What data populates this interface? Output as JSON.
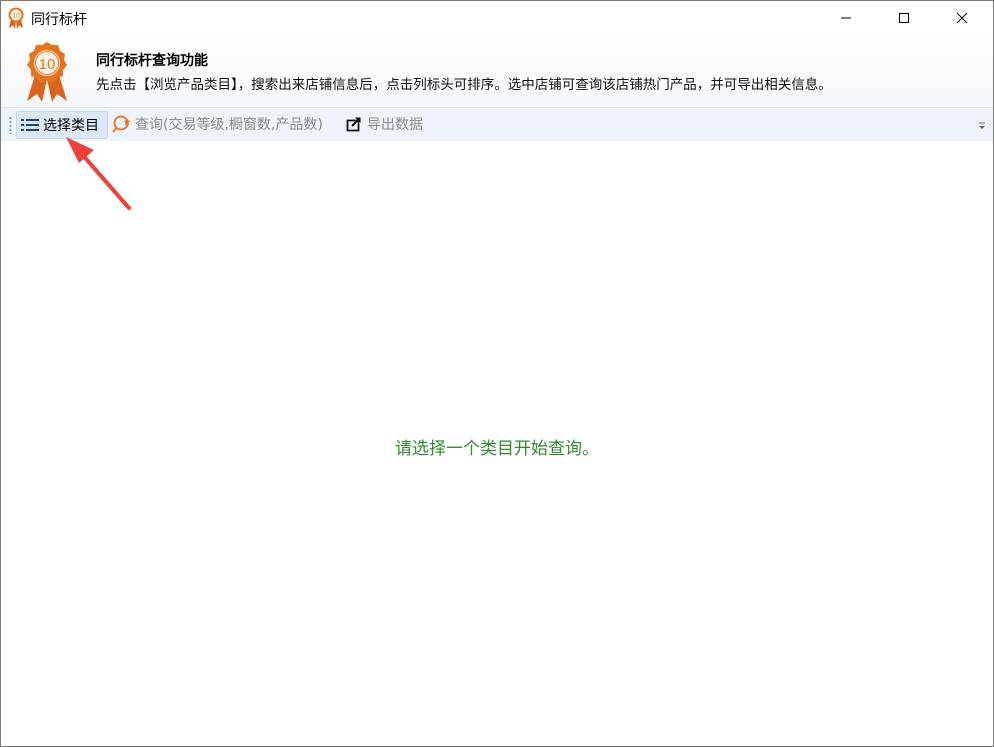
{
  "window": {
    "title": "同行标杆",
    "icon": "award-ribbon-icon",
    "badge_number": "10"
  },
  "banner": {
    "title": "同行标杆查询功能",
    "description": "先点击【浏览产品类目】，搜索出来店铺信息后，点击列标头可排序。选中店铺可查询该店铺热门产品，并可导出相关信息。"
  },
  "toolbar": {
    "select_category_label": "选择类目",
    "query_label": "查询(交易等级,橱窗数,产品数)",
    "export_label": "导出数据"
  },
  "content": {
    "empty_message": "请选择一个类目开始查询。"
  },
  "colors": {
    "accent_orange": "#e8731a",
    "message_green": "#2e8b2e",
    "annotation_red": "#f0403c"
  }
}
